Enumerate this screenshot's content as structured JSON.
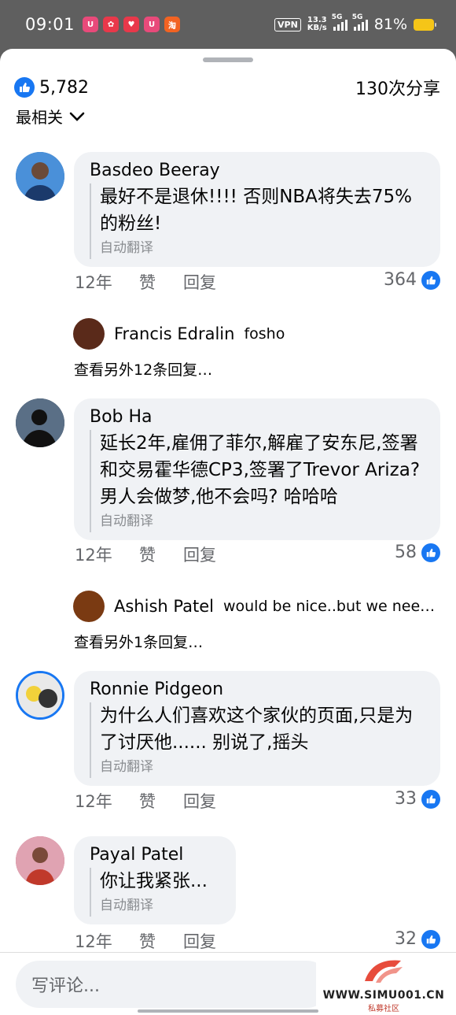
{
  "status_bar": {
    "time": "09:01",
    "apps": [
      {
        "icon": "red-app-icon",
        "color": "#e84a7a",
        "glyph": "U"
      },
      {
        "icon": "gift-app-icon",
        "color": "#e8384a",
        "glyph": "✿"
      },
      {
        "icon": "shop-app-icon",
        "color": "#e8384a",
        "glyph": "♥"
      },
      {
        "icon": "red-app-icon",
        "color": "#e84a7a",
        "glyph": "U"
      },
      {
        "icon": "taobao-icon",
        "color": "#f26322",
        "glyph": "淘"
      }
    ],
    "vpn": "VPN",
    "net_speed": "13.3",
    "net_unit": "KB/s",
    "signal_label_1": "5G",
    "signal_label_2": "5G",
    "battery_pct": "81%"
  },
  "header": {
    "like_count": "5,782",
    "share_count": "130次分享",
    "sort_label": "最相关"
  },
  "comments": [
    {
      "author": "Basdeo Beeray",
      "body": "最好不是退休!!!! 否则NBA将失去75%的粉丝!",
      "translate": "自动翻译",
      "time": "12年",
      "like": "赞",
      "reply": "回复",
      "likes": "364",
      "avatar_color": "#2b6cb0"
    },
    {
      "author": "Bob Ha",
      "body": "延长2年,雇佣了菲尔,解雇了安东尼,签署和交易霍华德CP3,签署了Trevor Ariza? 男人会做梦,他不会吗? 哈哈哈",
      "translate": "自动翻译",
      "time": "12年",
      "like": "赞",
      "reply": "回复",
      "likes": "58",
      "avatar_color": "#1c2a3a"
    },
    {
      "author": "Ronnie Pidgeon",
      "body": "为什么人们喜欢这个家伙的页面,只是为了讨厌他...... 别说了,摇头",
      "translate": "自动翻译",
      "time": "12年",
      "like": "赞",
      "reply": "回复",
      "likes": "33",
      "avatar_color": "#3a3a3a"
    },
    {
      "author": "Payal Patel",
      "body": "你让我紧张...",
      "translate": "自动翻译",
      "time": "12年",
      "like": "赞",
      "reply": "回复",
      "likes": "32",
      "avatar_color": "#c0566e"
    }
  ],
  "replies": [
    {
      "name": "Francis Edralin",
      "text": "fosho",
      "more": "查看另外12条回复…"
    },
    {
      "name": "Ashish Patel",
      "text": "would be nice..but we nee…",
      "more": "查看另外1条回复…"
    }
  ],
  "footer": {
    "placeholder": "写评论...",
    "watermark": "WWW.SIMU001.CN",
    "watermark_sub": "私募社区"
  },
  "colors": {
    "accent": "#1877f2",
    "bubble": "#f0f2f5",
    "muted": "#65676b"
  }
}
